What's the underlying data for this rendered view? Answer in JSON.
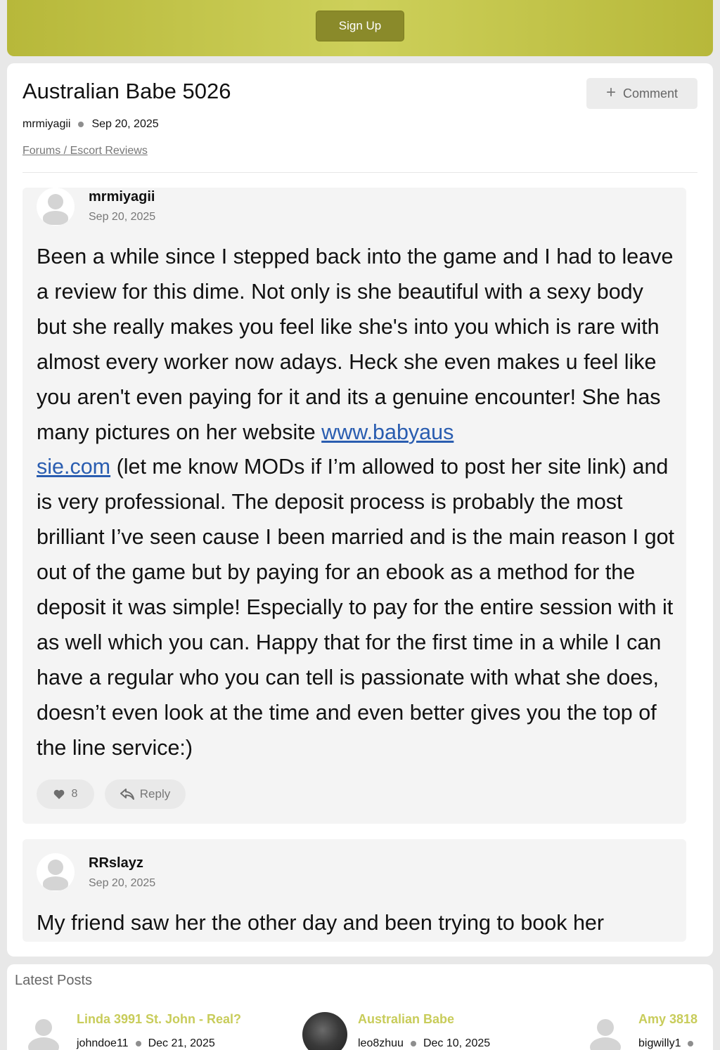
{
  "header": {
    "signup_label": "Sign Up"
  },
  "thread": {
    "title": "Australian Babe 5026",
    "comment_label": "Comment",
    "author": "mrmiyagii",
    "date": "Sep 20, 2025",
    "breadcrumb": "Forums / Escort Reviews"
  },
  "posts": [
    {
      "author": "mrmiyagii",
      "date": "Sep 20, 2025",
      "text_before_link": "Been a while since I stepped back into the game and I had to leave a review for this dime. Not only is she beautiful with a sexy body but she really makes you feel like she's into you which is rare with almost every worker now adays. Heck she even makes u feel like you aren't even paying for it and its a genuine encounter! She has many pictures on her website ",
      "link_line1": "www.babyaus",
      "link_line2": "sie.com",
      "text_after_link": " (let me know MODs if I’m allowed to post her site link) and is very professional. The deposit process is probably the most brilliant I’ve seen cause I been married and is the main reason I got out of the game but by paying for an ebook as a method for the deposit it was simple! Especially to pay for the entire session with it as well which you can. Happy that for the first time in a while I can have a regular who you can tell is passionate with what she does, doesn’t even look at the time and even better gives you the top of the line service:)",
      "likes": "8",
      "reply_label": "Reply"
    },
    {
      "author": "RRslayz",
      "date": "Sep 20, 2025",
      "text": "My friend saw her the other day and been trying to book her"
    }
  ],
  "latest": {
    "title": "Latest Posts",
    "items": [
      {
        "title": "Linda 3991 St. John - Real?",
        "author": "johndoe11",
        "date": "Dec 21, 2025"
      },
      {
        "title": "Australian Babe",
        "author": "leo8zhuu",
        "date": "Dec 10, 2025"
      },
      {
        "title": "Amy 3818",
        "author": "bigwilly1",
        "date": ""
      }
    ]
  },
  "colors": {
    "accent": "#c8cc5a",
    "signup_button": "#8a8a2a",
    "link": "#2a5db0"
  }
}
